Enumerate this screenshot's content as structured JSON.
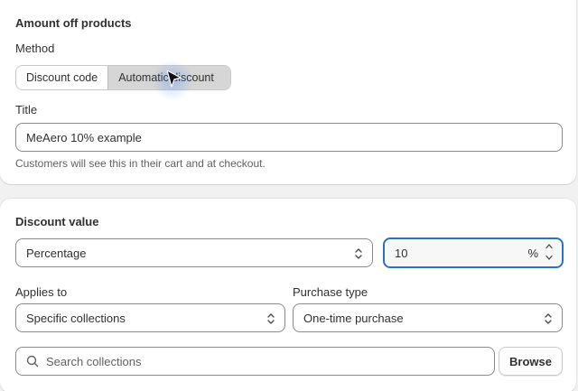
{
  "method_card": {
    "heading": "Amount off products",
    "method_label": "Method",
    "method_options": [
      "Discount code",
      "Automatic discount"
    ],
    "title_label": "Title",
    "title_value": "MeAero 10% example",
    "title_help": "Customers will see this in their cart and at checkout."
  },
  "value_card": {
    "heading": "Discount value",
    "value_type": "Percentage",
    "value": "10",
    "value_suffix": "%",
    "applies_label": "Applies to",
    "applies_value": "Specific collections",
    "purchase_label": "Purchase type",
    "purchase_value": "One-time purchase",
    "search_placeholder": "Search collections",
    "browse_label": "Browse"
  },
  "colors": {
    "focus_ring": "#2c6ecb",
    "selected_segment": "#d6d6d6"
  },
  "icons": [
    "chevron-up-down-icon",
    "stepper-up-icon",
    "stepper-down-icon",
    "search-icon",
    "mouse-cursor-icon"
  ]
}
